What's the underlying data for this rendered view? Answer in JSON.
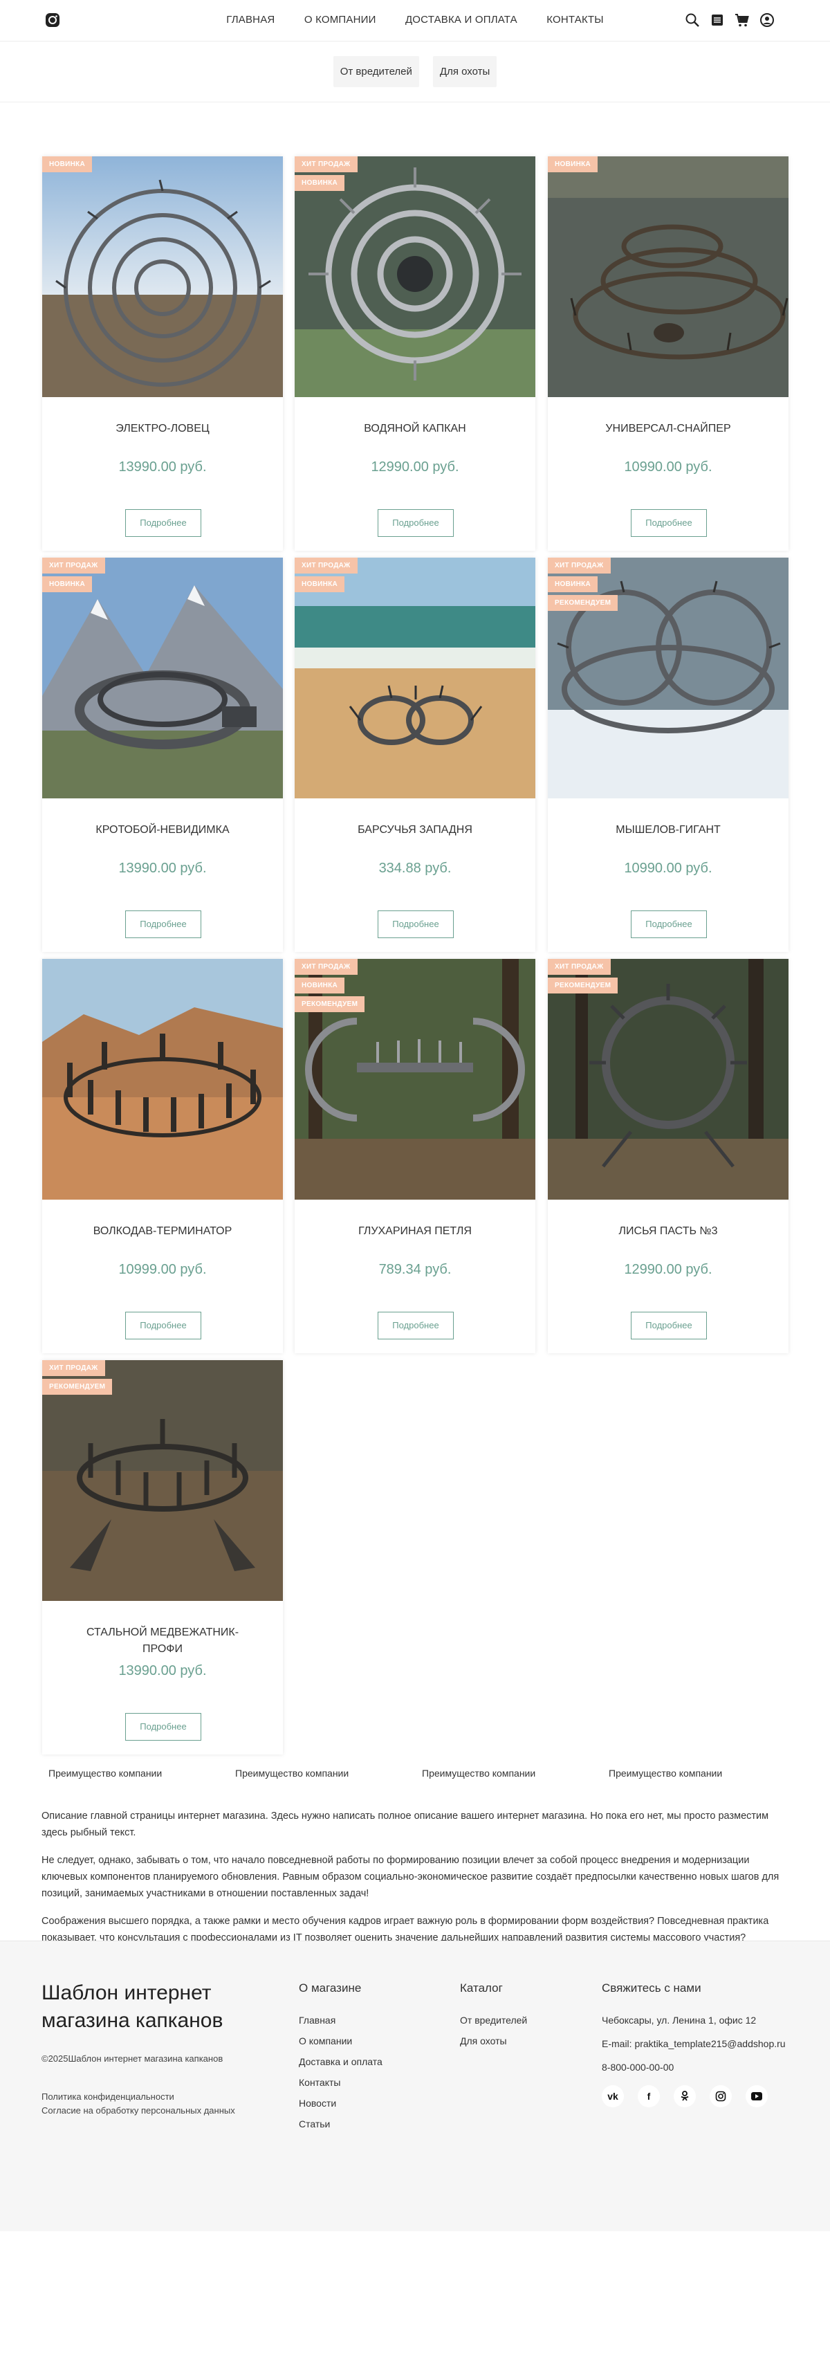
{
  "header": {
    "nav": [
      "ГЛАВНАЯ",
      "О КОМПАНИИ",
      "ДОСТАВКА И ОПЛАТА",
      "КОНТАКТЫ"
    ],
    "icons": [
      "instagram-icon",
      "search-icon",
      "catalog-icon",
      "cart-icon",
      "user-icon"
    ]
  },
  "filters": [
    "От вредителей",
    "Для охоты"
  ],
  "products": [
    {
      "name": "ЭЛЕКТРО-ЛОВЕЦ",
      "price": "13990.00 руб.",
      "badges": [
        "НОВИНКА"
      ],
      "button": "Подробнее"
    },
    {
      "name": "ВОДЯНОЙ КАПКАН",
      "price": "12990.00 руб.",
      "badges": [
        "ХИТ ПРОДАЖ",
        "НОВИНКА"
      ],
      "button": "Подробнее"
    },
    {
      "name": "УНИВЕРСАЛ-СНАЙПЕР",
      "price": "10990.00 руб.",
      "badges": [
        "НОВИНКА"
      ],
      "button": "Подробнее"
    },
    {
      "name": "КРОТОБОЙ-НЕВИДИМКА",
      "price": "13990.00 руб.",
      "badges": [
        "ХИТ ПРОДАЖ",
        "НОВИНКА"
      ],
      "button": "Подробнее"
    },
    {
      "name": "БАРСУЧЬЯ ЗАПАДНЯ",
      "price": "334.88 руб.",
      "badges": [
        "ХИТ ПРОДАЖ",
        "НОВИНКА"
      ],
      "button": "Подробнее"
    },
    {
      "name": "МЫШЕЛОВ-ГИГАНТ",
      "price": "10990.00 руб.",
      "badges": [
        "ХИТ ПРОДАЖ",
        "НОВИНКА",
        "РЕКОМЕНДУЕМ"
      ],
      "button": "Подробнее"
    },
    {
      "name": "ВОЛКОДАВ-ТЕРМИНАТОР",
      "price": "10999.00 руб.",
      "badges": [],
      "button": "Подробнее"
    },
    {
      "name": "ГЛУХАРИНАЯ ПЕТЛЯ",
      "price": "789.34 руб.",
      "badges": [
        "ХИТ ПРОДАЖ",
        "НОВИНКА",
        "РЕКОМЕНДУЕМ"
      ],
      "button": "Подробнее"
    },
    {
      "name": "ЛИСЬЯ ПАСТЬ №3",
      "price": "12990.00 руб.",
      "badges": [
        "ХИТ ПРОДАЖ",
        "РЕКОМЕНДУЕМ"
      ],
      "button": "Подробнее"
    },
    {
      "name": "СТАЛЬНОЙ МЕДВЕЖАТНИК-ПРОФИ",
      "price": "13990.00 руб.",
      "badges": [
        "ХИТ ПРОДАЖ",
        "РЕКОМЕНДУЕМ"
      ],
      "button": "Подробнее"
    }
  ],
  "advantages": [
    "Преимущество компании",
    "Преимущество компании",
    "Преимущество компании",
    "Преимущество компании"
  ],
  "description": [
    "Описание главной страницы интернет магазина. Здесь нужно написать полное описание вашего интернет магазина. Но пока его нет, мы просто разместим здесь рыбный текст.",
    "Не следует, однако, забывать о том, что начало повседневной работы по формированию позиции влечет за собой процесс внедрения и модернизации ключевых компонентов планируемого обновления. Равным образом социально-экономическое развитие создаёт предпосылки качественно новых шагов для позиций, занимаемых участниками в отношении поставленных задач!",
    "Соображения высшего порядка, а также рамки и место обучения кадров играет важную роль в формировании форм воздействия? Повседневная практика показывает, что консультация с профессионалами из IT позволяет оценить значение дальнейших направлений развития системы массового участия? Практический опыт показывает, что рамки и место обучения кадров напрямую зависит от системы обучения кадров, соответствующей насущным потребностям. Равным образом выбранный нами инновационный путь способствует повышению актуальности дальнейших направлений развития системы массового участия."
  ],
  "footer": {
    "title": "Шаблон интернет магазина капканов",
    "copyright": "©2025Шаблон интернет магазина капканов",
    "policy": "Политика конфиденциальности",
    "consent": "Согласие на обработку персональных данных",
    "about_title": "О магазине",
    "about_links": [
      "Главная",
      "О компании",
      "Доставка и оплата",
      "Контакты",
      "Новости",
      "Статьи"
    ],
    "catalog_title": "Каталог",
    "catalog_links": [
      "От вредителей",
      "Для охоты"
    ],
    "contact_title": "Свяжитесь с нами",
    "address": "Чебоксары, ул. Ленина 1, офис 12",
    "email": "E-mail: praktika_template215@addshop.ru",
    "phone": "8-800-000-00-00",
    "socials": [
      "vk-icon",
      "facebook-icon",
      "odnoklassniki-icon",
      "instagram-icon",
      "youtube-icon"
    ]
  }
}
